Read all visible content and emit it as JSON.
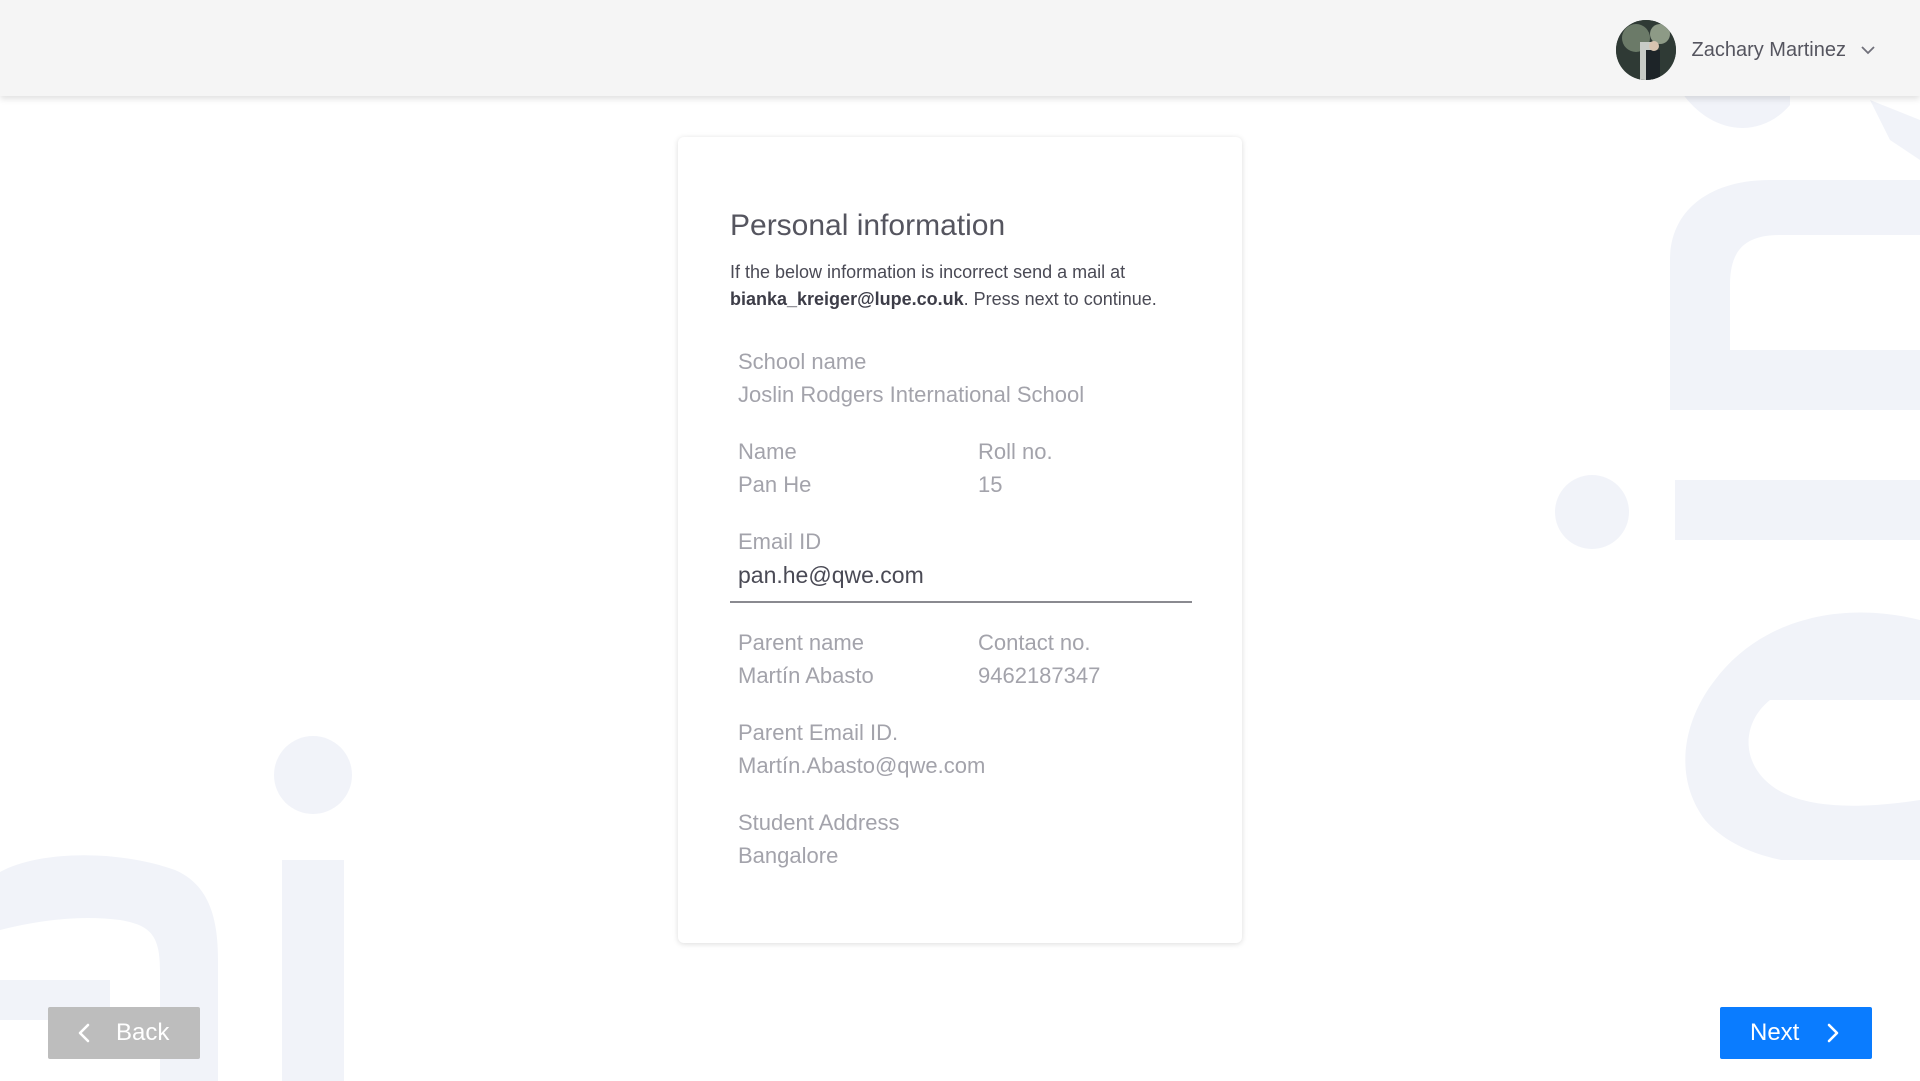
{
  "header": {
    "user_name": "Zachary Martinez",
    "avatar_icon": "user-avatar",
    "dropdown_icon": "chevron-down-icon"
  },
  "card": {
    "title": "Personal information",
    "description_prefix": "If the below information is incorrect send a mail at",
    "support_email": "bianka_kreiger@lupe.co.uk",
    "description_suffix": ". Press next to continue.",
    "fields": {
      "school_name": {
        "label": "School name",
        "value": "Joslin Rodgers International School"
      },
      "name": {
        "label": "Name",
        "value": "Pan He"
      },
      "roll_no": {
        "label": "Roll no.",
        "value": "15"
      },
      "email": {
        "label": "Email ID",
        "value": "pan.he@qwe.com"
      },
      "parent_name": {
        "label": "Parent name",
        "value": "Martín Abasto"
      },
      "contact_no": {
        "label": "Contact no.",
        "value": "9462187347"
      },
      "parent_email": {
        "label": "Parent Email ID.",
        "value": "Martín.Abasto@qwe.com"
      },
      "student_address": {
        "label": "Student Address",
        "value": "Bangalore"
      }
    }
  },
  "navigation": {
    "back_label": "Back",
    "back_icon": "chevron-left-icon",
    "next_label": "Next",
    "next_icon": "chevron-right-icon"
  },
  "colors": {
    "primary": "#0a7cff",
    "disabled": "#bdbdbd",
    "background_decoration": "#f1f3f9"
  }
}
